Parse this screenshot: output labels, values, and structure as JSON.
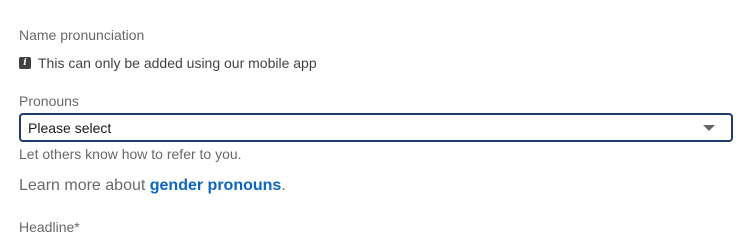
{
  "name_pronunciation": {
    "label": "Name pronunciation",
    "info_text": "This can only be added using our mobile app",
    "info_icon": "info-icon"
  },
  "pronouns": {
    "label": "Pronouns",
    "selected_value": "Please select",
    "helper_text": "Let others know how to refer to you.",
    "learn_more_prefix": "Learn more about ",
    "learn_more_link": "gender pronouns",
    "learn_more_suffix": "."
  },
  "headline": {
    "label": "Headline*"
  },
  "colors": {
    "accent_link": "#0a66c2",
    "select_border": "#1f3b6e"
  }
}
